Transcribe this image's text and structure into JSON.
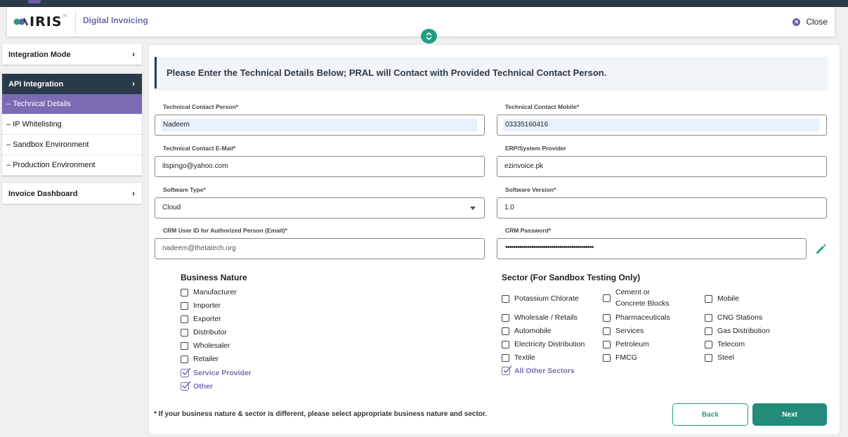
{
  "header": {
    "logo_text": "IRIS",
    "logo_reg": "RC",
    "app_title": "Digital Invoicing",
    "close_label": "Close"
  },
  "sidebar": {
    "integration_mode": "Integration Mode",
    "api_integration": "API Integration",
    "items": [
      {
        "label": "Technical Details"
      },
      {
        "label": "IP Whitelisting"
      },
      {
        "label": "Sandbox Environment"
      },
      {
        "label": "Production Environment"
      }
    ],
    "invoice_dashboard": "Invoice Dashboard",
    "item_prefix": "– "
  },
  "banner": "Please Enter the Technical Details Below; PRAL will Contact with Provided Technical Contact Person.",
  "form": {
    "tech_contact_person": {
      "label": "Technical Contact Person*",
      "value": "Nadeem"
    },
    "tech_contact_mobile": {
      "label": "Technical Contact Mobile*",
      "value": "03335160416"
    },
    "tech_contact_email": {
      "label": "Technical Contact E-Mail*",
      "value": "itspingo@yahoo.com"
    },
    "erp_provider": {
      "label": "ERP/System Provider",
      "value": "ezinvoice.pk"
    },
    "software_type": {
      "label": "Software Type*",
      "value": "Cloud"
    },
    "software_version": {
      "label": "Software Version*",
      "value": "1.0"
    },
    "crm_user_id": {
      "label": "CRM User ID for Authorized Person (Email)*",
      "value": "nadeem@thetatech.org"
    },
    "crm_password": {
      "label": "CRM Password*",
      "value": "••••••••••••••••••••••••••••••••••••••••••••"
    }
  },
  "business_nature": {
    "title": "Business Nature",
    "options": [
      {
        "label": "Manufacturer",
        "checked": false
      },
      {
        "label": "Importer",
        "checked": false
      },
      {
        "label": "Exporter",
        "checked": false
      },
      {
        "label": "Distributor",
        "checked": false
      },
      {
        "label": "Wholesaler",
        "checked": false
      },
      {
        "label": "Retailer",
        "checked": false
      },
      {
        "label": "Service Provider",
        "checked": true
      },
      {
        "label": "Other",
        "checked": true
      }
    ]
  },
  "sector": {
    "title": "Sector (For Sandbox Testing Only)",
    "options": [
      {
        "label": "Potassium Chlorate",
        "checked": false
      },
      {
        "label": "Cement or Concrete Blocks",
        "checked": false
      },
      {
        "label": "Mobile",
        "checked": false
      },
      {
        "label": "Wholesale / Retails",
        "checked": false
      },
      {
        "label": "Pharmaceuticals",
        "checked": false
      },
      {
        "label": "CNG Stations",
        "checked": false
      },
      {
        "label": "Automobile",
        "checked": false
      },
      {
        "label": "Services",
        "checked": false
      },
      {
        "label": "Gas Distribution",
        "checked": false
      },
      {
        "label": "Electricity Distribution",
        "checked": false
      },
      {
        "label": "Petroleum",
        "checked": false
      },
      {
        "label": "Telecom",
        "checked": false
      },
      {
        "label": "Textile",
        "checked": false
      },
      {
        "label": "FMCG",
        "checked": false
      },
      {
        "label": "Steel",
        "checked": false
      },
      {
        "label": "All Other Sectors",
        "checked": true
      }
    ]
  },
  "note": "* If your business nature & sector is different, please select appropriate business nature and sector.",
  "buttons": {
    "back": "Back",
    "next": "Next"
  },
  "colors": {
    "accent_purple": "#7a6bb2",
    "accent_green": "#1f9e82",
    "dark_navy": "#2b3a48"
  }
}
